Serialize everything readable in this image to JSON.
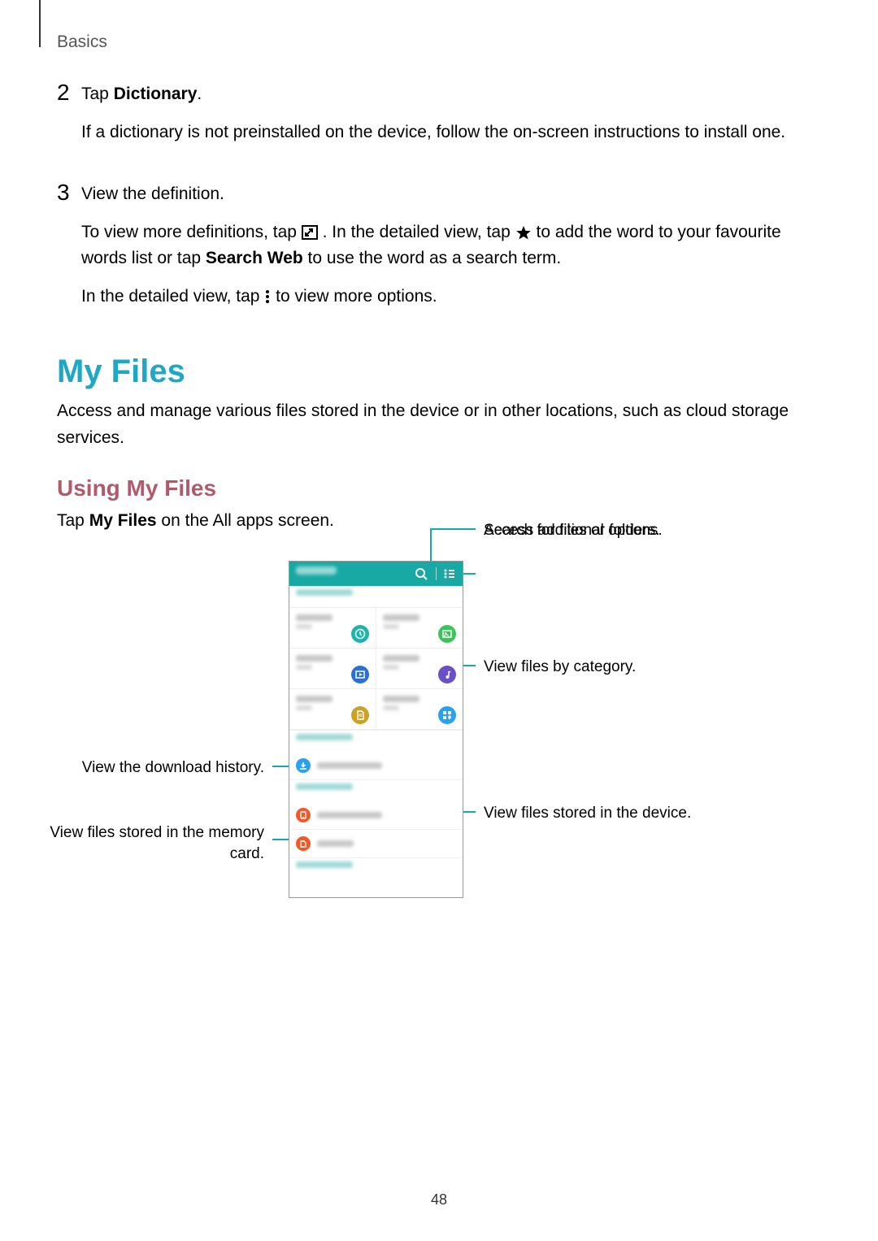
{
  "header": {
    "section": "Basics"
  },
  "steps": {
    "s2": {
      "num": "2",
      "line1a": "Tap ",
      "line1b": "Dictionary",
      "line1c": ".",
      "line2": "If a dictionary is not preinstalled on the device, follow the on-screen instructions to install one."
    },
    "s3": {
      "num": "3",
      "line1": "View the definition.",
      "line2a": "To view more definitions, tap ",
      "line2b": ". In the detailed view, tap ",
      "line2c": " to add the word to your favourite words list or tap ",
      "line2d": "Search Web",
      "line2e": " to use the word as a search term.",
      "line3a": "In the detailed view, tap ",
      "line3b": " to view more options."
    }
  },
  "myfiles": {
    "heading": "My Files",
    "desc": "Access and manage various files stored in the device or in other locations, such as cloud storage services.",
    "sub": "Using My Files",
    "tap_a": "Tap ",
    "tap_b": "My Files",
    "tap_c": " on the All apps screen."
  },
  "callouts": {
    "search": "Search for files or folders.",
    "options": "Access additional options.",
    "category": "View files by category.",
    "device": "View files stored in the device.",
    "download": "View the download history.",
    "sdcard_l1": "View files stored in the memory",
    "sdcard_l2": "card."
  },
  "page_number": "48",
  "tile_colors": {
    "recent": "#1db4ae",
    "images": "#3cc35a",
    "videos": "#2a6fd6",
    "audio": "#6a4fc9",
    "documents": "#c9a227",
    "downloaded": "#2aa0f0"
  },
  "row_colors": {
    "download": "#2aa0f0",
    "device": "#f05a2a",
    "sd": "#f05a2a"
  }
}
